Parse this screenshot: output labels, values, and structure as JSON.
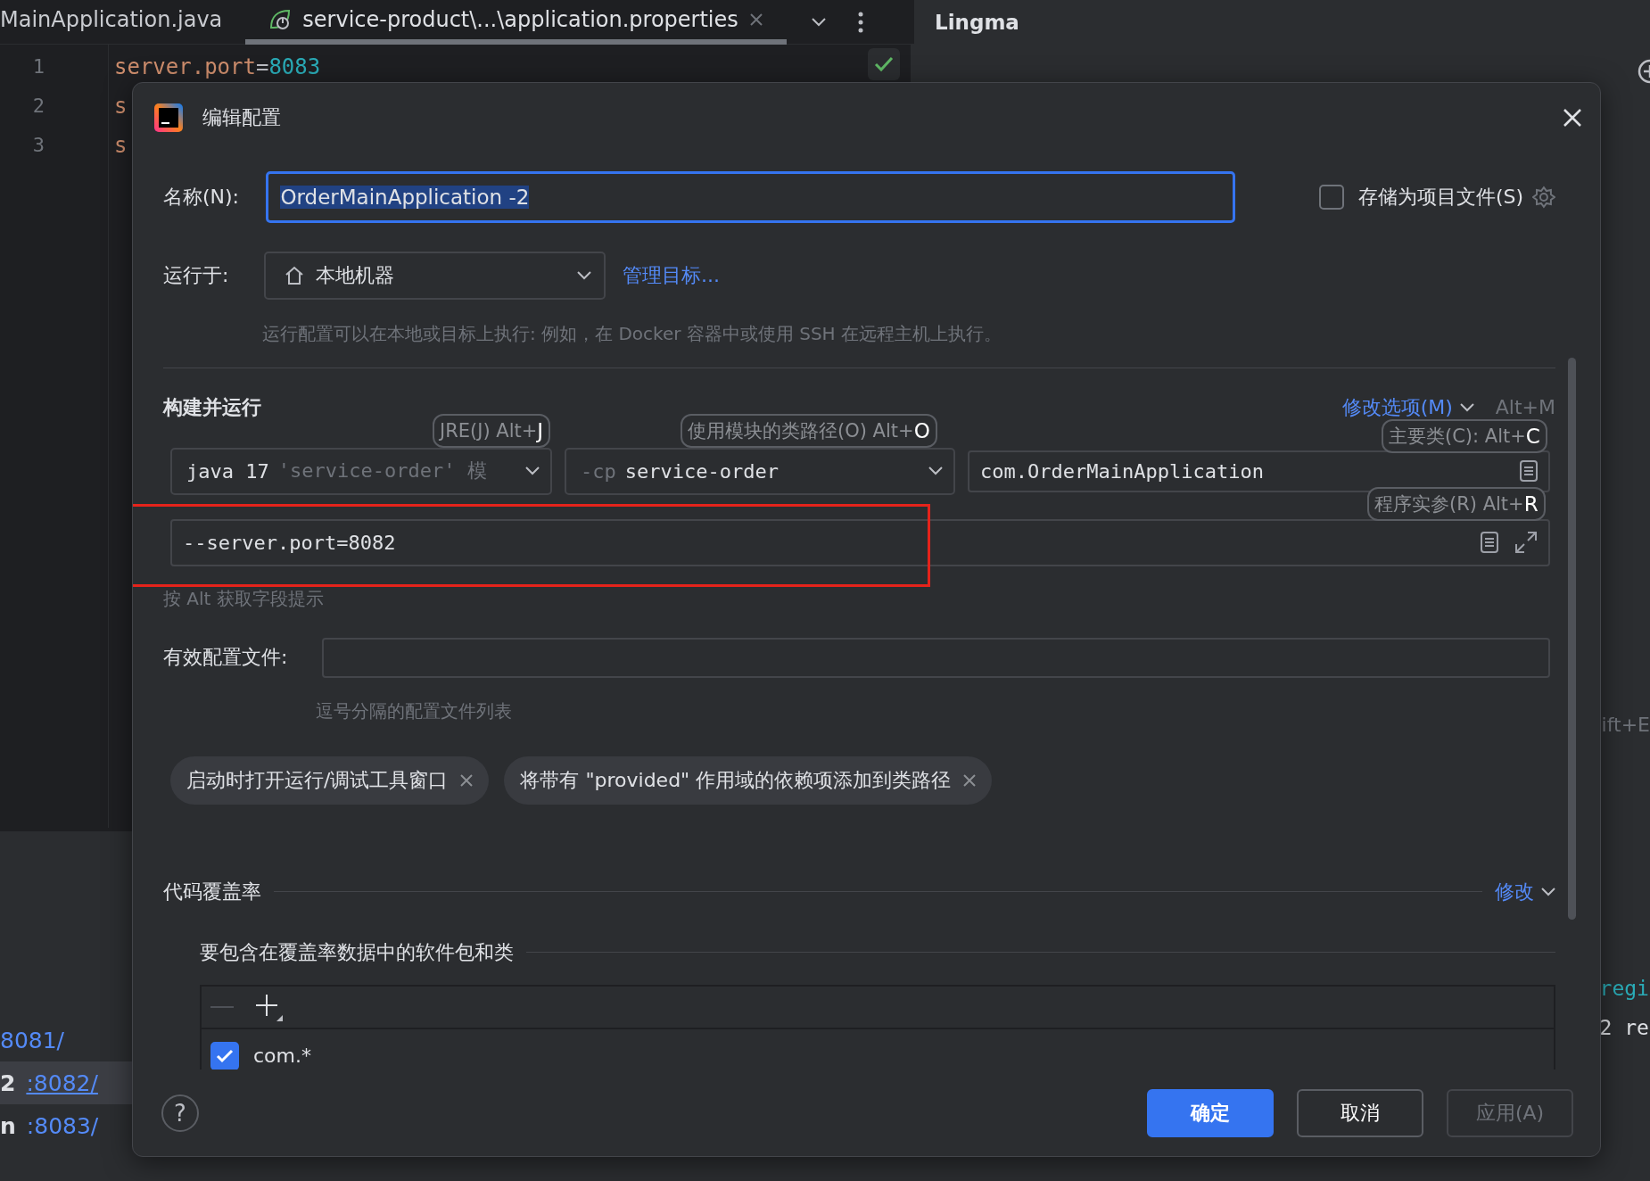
{
  "editor_tabs": [
    {
      "label": "MainApplication.java",
      "selected": false,
      "closable": false
    },
    {
      "label": "service-product\\...\\application.properties",
      "selected": true,
      "closable": true
    }
  ],
  "editor": {
    "lines": [
      {
        "number": "1",
        "code": [
          {
            "kind": "key",
            "text": "server.port"
          },
          {
            "kind": "op",
            "text": "="
          },
          {
            "kind": "value",
            "text": "8083"
          }
        ]
      },
      {
        "number": "2",
        "code": [
          {
            "kind": "key",
            "text": "s"
          }
        ]
      },
      {
        "number": "3",
        "code": [
          {
            "kind": "key",
            "text": "s"
          }
        ]
      }
    ]
  },
  "run_output": [
    {
      "link": "8081/",
      "selected": false
    },
    {
      "prefix": "2",
      "link": ":8082/",
      "selected": true
    },
    {
      "prefix": "n",
      "link": ":8083/",
      "selected": false
    }
  ],
  "side_panel": {
    "title": "Lingma",
    "fragments": [
      {
        "kind": "shortcut",
        "text": "ift+E"
      },
      {
        "kind": "keyword",
        "text": "regi"
      },
      {
        "kind": "plain",
        "text": "2 re"
      }
    ]
  },
  "dialog": {
    "title": "编辑配置",
    "name": {
      "label": "名称(N):",
      "value": "OrderMainApplication -2",
      "text_selected": true
    },
    "store_as_file": {
      "label": "存储为项目文件(S)",
      "checked": false
    },
    "run_on": {
      "label": "运行于:",
      "value": "本地机器",
      "link": "管理目标..."
    },
    "run_on_hint": "运行配置可以在本地或目标上执行: 例如，在 Docker 容器中或使用 SSH 在远程主机上执行。",
    "build_run": {
      "title": "构建并运行",
      "modify_link": "修改选项(M)",
      "modify_shortcut": "Alt+M",
      "jre": {
        "value": "java 17",
        "detail": "'service-order' 模",
        "hint": "JRE(J) Alt+**J**"
      },
      "classpath": {
        "prefix": "-cp",
        "value": "service-order",
        "hint": "使用模块的类路径(O) Alt+**O**"
      },
      "main_class": {
        "value": "com.OrderMainApplication",
        "hint": "主要类(C): Alt+**C**"
      },
      "program_args": {
        "value": "--server.port=8082",
        "hint": "程序实参(R) Alt+**R**",
        "highlighted": true
      }
    },
    "alt_hint": "按 Alt 获取字段提示",
    "profiles": {
      "label": "有效配置文件:",
      "hint": "逗号分隔的配置文件列表"
    },
    "chips": [
      {
        "label": "启动时打开运行/调试工具窗口"
      },
      {
        "label": "将带有 \"provided\" 作用域的依赖项添加到类路径"
      }
    ],
    "coverage": {
      "title": "代码覆盖率",
      "modify_link": "修改",
      "subtitle": "要包含在覆盖率数据中的软件包和类",
      "rows": [
        {
          "label": "com.*",
          "checked": true
        }
      ]
    },
    "help": "?",
    "buttons": [
      {
        "label": "确定",
        "kind": "primary",
        "disabled": false
      },
      {
        "label": "取消",
        "kind": "secondary",
        "disabled": false
      },
      {
        "label": "应用(A)",
        "kind": "secondary",
        "disabled": true
      }
    ]
  }
}
